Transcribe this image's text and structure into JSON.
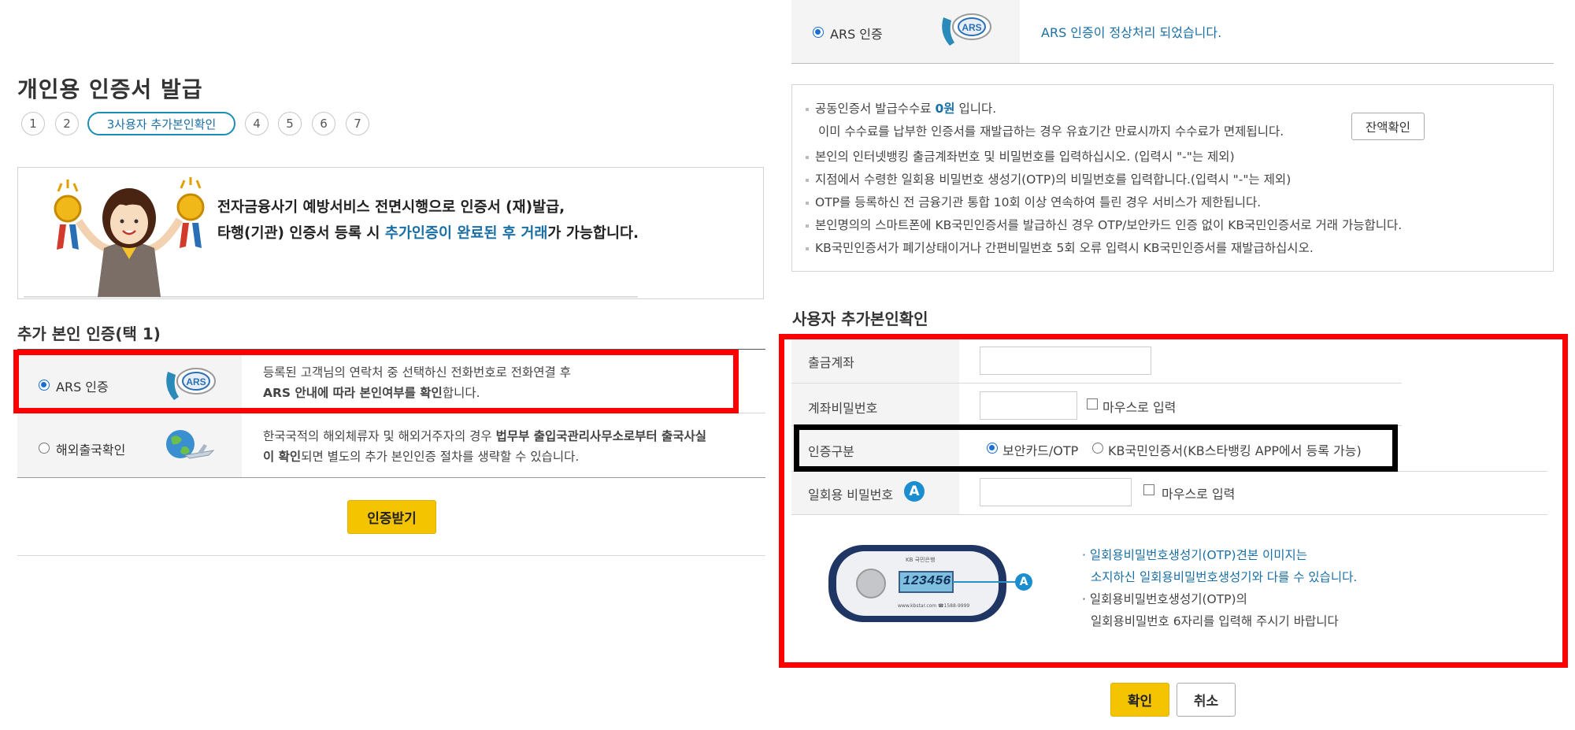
{
  "left": {
    "page_title": "개인용 인증서 발급",
    "steps": [
      "1",
      "2",
      "3사용자 추가본인확인",
      "4",
      "5",
      "6",
      "7"
    ],
    "notice": {
      "line1": "전자금융사기 예방서비스 전면시행으로 인증서 (재)발급,",
      "line2_a": "타행(기관) 인증서 등록 시 ",
      "line2_highlight": "추가인증이 완료된 후 거래",
      "line2_b": "가 가능합니다."
    },
    "auth_heading": "추가 본인 인증(택 1)",
    "options": [
      {
        "label": "ARS 인증",
        "icon": "ars-phone-icon",
        "desc1": "등록된 고객님의 연락처 중 선택하신 전화번호로 전화연결 후",
        "desc2_bold": "ARS 안내에 따라 본인여부를 확인",
        "desc2_rest": "합니다."
      },
      {
        "label": "해외출국확인",
        "icon": "globe-airplane-icon",
        "desc1_a": "한국국적의 해외체류자 및 해외거주자의 경우 ",
        "desc1_bold": "법무부 출입국관리사무소로부터 출국사실",
        "desc2_bold": "이 확인",
        "desc2_rest": "되면 별도의 추가 본인인증 절차를 생략할 수 있습니다."
      }
    ],
    "submit_label": "인증받기"
  },
  "right": {
    "ars_label": "ARS 인증",
    "ars_status": "ARS 인증이 정상처리 되었습니다.",
    "info": {
      "fee_a": "공동인증서 발급수수료 ",
      "fee_bold": "0원",
      "fee_b": " 입니다.",
      "fee_line2": "이미 수수료를 납부한 인증서를 재발급하는 경우 유효기간 만료시까지 수수료가 면제됩니다.",
      "balance_button": "잔액확인",
      "line3": "본인의 인터넷뱅킹 출금계좌번호 및 비밀번호를 입력하십시오. (입력시 \"-\"는 제외)",
      "line4": "지점에서 수령한 일회용 비밀번호 생성기(OTP)의 비밀번호를 입력합니다.(입력시 \"-\"는 제외)",
      "line5": "OTP를 등록하신 전 금융기관 통합 10회 이상 연속하여 틀린 경우 서비스가 제한됩니다.",
      "line6": "본인명의의 스마트폰에 KB국민인증서를 발급하신 경우 OTP/보안카드 인증 없이 KB국민인증서로 거래 가능합니다.",
      "line7": "KB국민인증서가 폐기상태이거나 간편비밀번호 5회 오류 입력시 KB국민인증서를 재발급하십시오."
    },
    "user_heading": "사용자 추가본인확인",
    "fields": {
      "account_label": "출금계좌",
      "account_value": "",
      "password_label": "계좌비밀번호",
      "password_value": "",
      "mouse_input_label": "마우스로 입력",
      "auth_type_label": "인증구분",
      "auth_opt1": "보안카드/OTP",
      "auth_opt2": "KB국민인증서(KB스타뱅킹 APP에서 등록 가능)",
      "otp_label": "일회용 비밀번호",
      "otp_badge": "A",
      "otp_value": "",
      "otp_mouse_label": "마우스로 입력"
    },
    "otp_device": {
      "display": "123456",
      "badge": "A",
      "brand": "KB 국민은행",
      "footer": "www.kbstar.com ☎1588-9999"
    },
    "otp_notes": {
      "n1a": "일회용비밀번호생성기(OTP)견본 이미지는",
      "n1b": "소지하신 일회용비밀번호생성기와 다를 수 있습니다.",
      "n2a": "일회용비밀번호생성기(OTP)의",
      "n2b": "일회용비밀번호 6자리를 입력해 주시기 바랍니다"
    },
    "confirm_label": "확인",
    "cancel_label": "취소"
  },
  "colors": {
    "accent_blue": "#1a6fa5",
    "highlight_red": "#ff0000",
    "button_yellow": "#f4c400"
  }
}
